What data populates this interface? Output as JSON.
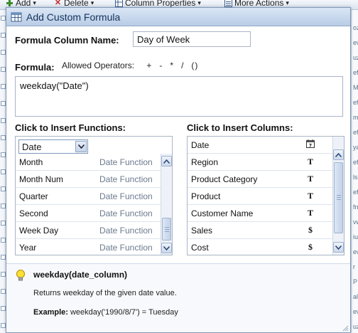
{
  "toolbar": {
    "add_label": "Add",
    "delete_label": "Delete",
    "column_properties_label": "Column Properties",
    "more_actions_label": "More Actions"
  },
  "background_right_fragments": [
    "oza",
    "ewt",
    "uza",
    "efr",
    "Mo",
    "efr",
    "mit",
    "efr",
    "ya",
    "efr",
    "lsu",
    "efr",
    "fn",
    "vw",
    "iu",
    "ew",
    "r",
    "P",
    "al",
    "ew",
    "uz"
  ],
  "dialog": {
    "title": "Add Custom Formula",
    "column_name_label": "Formula Column Name:",
    "column_name_value": "Day of Week",
    "formula_label": "Formula:",
    "allowed_operators_label": "Allowed Operators:",
    "operators": [
      "+",
      "-",
      "*",
      "/",
      "()"
    ],
    "formula_value": "weekday(\"Date\")"
  },
  "functions_panel": {
    "heading": "Click to Insert Functions:",
    "category_selected": "Date",
    "items": [
      {
        "name": "Month",
        "type": "Date Function"
      },
      {
        "name": "Month Num",
        "type": "Date Function"
      },
      {
        "name": "Quarter",
        "type": "Date Function"
      },
      {
        "name": "Second",
        "type": "Date Function"
      },
      {
        "name": "Week Day",
        "type": "Date Function"
      },
      {
        "name": "Year",
        "type": "Date Function"
      }
    ]
  },
  "columns_panel": {
    "heading": "Click to Insert Columns:",
    "items": [
      {
        "name": "Date",
        "type_icon": "calendar-icon"
      },
      {
        "name": "Region",
        "type_icon": "T"
      },
      {
        "name": "Product Category",
        "type_icon": "T"
      },
      {
        "name": "Product",
        "type_icon": "T"
      },
      {
        "name": "Customer Name",
        "type_icon": "T"
      },
      {
        "name": "Sales",
        "type_icon": "$"
      },
      {
        "name": "Cost",
        "type_icon": "$"
      }
    ]
  },
  "help": {
    "syntax": "weekday(date_column)",
    "description": "Returns weekday of the given date value.",
    "example_label": "Example:",
    "example_text": "weekday('1990/8/7') = Tuesday"
  },
  "colors": {
    "title_bar": "#b9cde6",
    "title_text": "#15325c",
    "border": "#a9b5c6",
    "muted_text": "#6c7a8e"
  }
}
